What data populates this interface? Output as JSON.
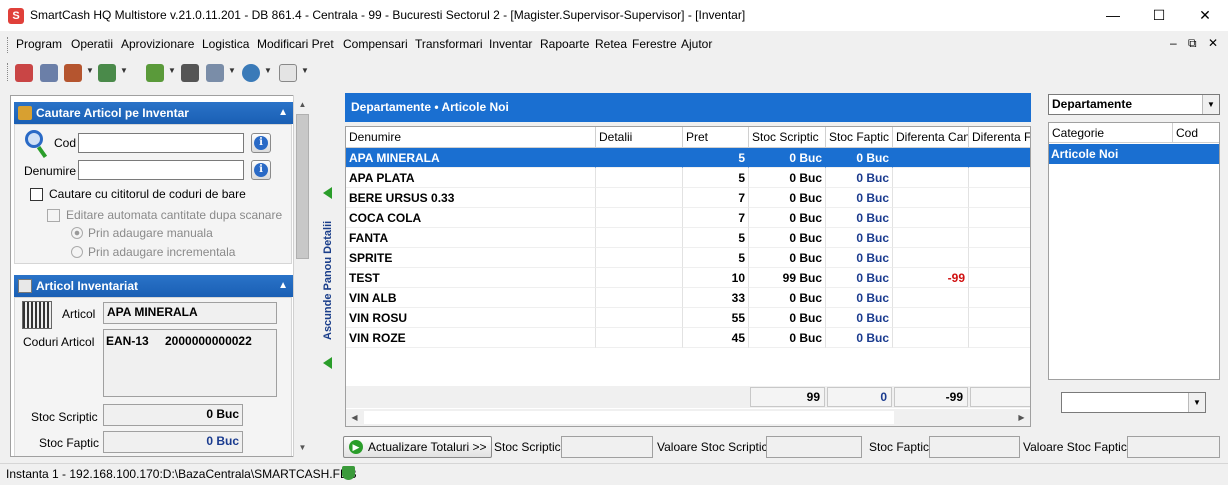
{
  "window": {
    "title": "SmartCash HQ Multistore v.21.0.11.201 - DB 861.4 - Centrala - 99 - Bucuresti Sectorul 2 - [Magister.Supervisor-Supervisor] - [Inventar]",
    "app_icon_letter": "S"
  },
  "menu": {
    "items": [
      "Program",
      "Operatii",
      "Aprovizionare",
      "Logistica",
      "Modificari Pret",
      "Compensari",
      "Transformari",
      "Inventar",
      "Rapoarte",
      "Retea",
      "Ferestre",
      "Ajutor"
    ]
  },
  "left_panel": {
    "search": {
      "header": "Cautare Articol pe Inventar",
      "code_label": "Cod",
      "code_value": "",
      "name_label": "Denumire",
      "name_value": "",
      "barcode_reader_label": "Cautare cu cititorul de coduri de bare",
      "auto_edit_label": "Editare automata cantitate dupa scanare",
      "radio_manual": "Prin adaugare manuala",
      "radio_incremental": "Prin adaugare incrementala"
    },
    "article": {
      "header": "Articol Inventariat",
      "article_label": "Articol",
      "article_value": "APA MINERALA",
      "codes_label": "Coduri Articol",
      "code_type": "EAN-13",
      "code_value": "2000000000022",
      "stoc_scriptic_label": "Stoc Scriptic",
      "stoc_scriptic_value": "0 Buc",
      "stoc_faptic_label": "Stoc Faptic",
      "stoc_faptic_value": "0 Buc"
    }
  },
  "side_strip": {
    "label": "Ascunde Panou Detalii"
  },
  "grid": {
    "title": "Departamente • Articole Noi",
    "columns": [
      "Denumire",
      "Detalii",
      "Pret",
      "Stoc Scriptic",
      "Stoc Faptic",
      "Diferenta Can",
      "Diferenta F"
    ],
    "rows": [
      {
        "name": "APA MINERALA",
        "details": "",
        "price": "5",
        "scriptic": "0 Buc",
        "faptic": "0 Buc",
        "diff": "",
        "selected": true
      },
      {
        "name": "APA PLATA",
        "details": "",
        "price": "5",
        "scriptic": "0 Buc",
        "faptic": "0 Buc",
        "diff": ""
      },
      {
        "name": "BERE URSUS 0.33",
        "details": "",
        "price": "7",
        "scriptic": "0 Buc",
        "faptic": "0 Buc",
        "diff": ""
      },
      {
        "name": "COCA COLA",
        "details": "",
        "price": "7",
        "scriptic": "0 Buc",
        "faptic": "0 Buc",
        "diff": ""
      },
      {
        "name": "FANTA",
        "details": "",
        "price": "5",
        "scriptic": "0 Buc",
        "faptic": "0 Buc",
        "diff": ""
      },
      {
        "name": "SPRITE",
        "details": "",
        "price": "5",
        "scriptic": "0 Buc",
        "faptic": "0 Buc",
        "diff": ""
      },
      {
        "name": "TEST",
        "details": "",
        "price": "10",
        "scriptic": "99 Buc",
        "faptic": "0 Buc",
        "diff": "-99"
      },
      {
        "name": "VIN ALB",
        "details": "",
        "price": "33",
        "scriptic": "0 Buc",
        "faptic": "0 Buc",
        "diff": ""
      },
      {
        "name": "VIN ROSU",
        "details": "",
        "price": "55",
        "scriptic": "0 Buc",
        "faptic": "0 Buc",
        "diff": ""
      },
      {
        "name": "VIN ROZE",
        "details": "",
        "price": "45",
        "scriptic": "0 Buc",
        "faptic": "0 Buc",
        "diff": ""
      }
    ],
    "totals": {
      "scriptic": "99",
      "faptic": "0",
      "diff": "-99"
    }
  },
  "bottom_bar": {
    "refresh_button": "Actualizare Totaluri >>",
    "stoc_scriptic_label": "Stoc Scriptic",
    "valoare_scriptic_label": "Valoare Stoc Scriptic",
    "stoc_faptic_label": "Stoc Faptic",
    "valoare_faptic_label": "Valoare Stoc Faptic"
  },
  "right_panel": {
    "selector_value": "Departamente",
    "list_columns": [
      "Categorie",
      "Cod"
    ],
    "list_items": [
      {
        "category": "Articole Noi",
        "code": "",
        "selected": true
      }
    ]
  },
  "status_bar": {
    "text": "Instanta 1 - 192.168.100.170:D:\\BazaCentrala\\SMARTCASH.FDB"
  },
  "colors": {
    "accent": "#1a6fd1",
    "positive_arrow": "#2a9d2a",
    "negative_value": "#d01010",
    "faptic_value": "#1a3b8f"
  }
}
